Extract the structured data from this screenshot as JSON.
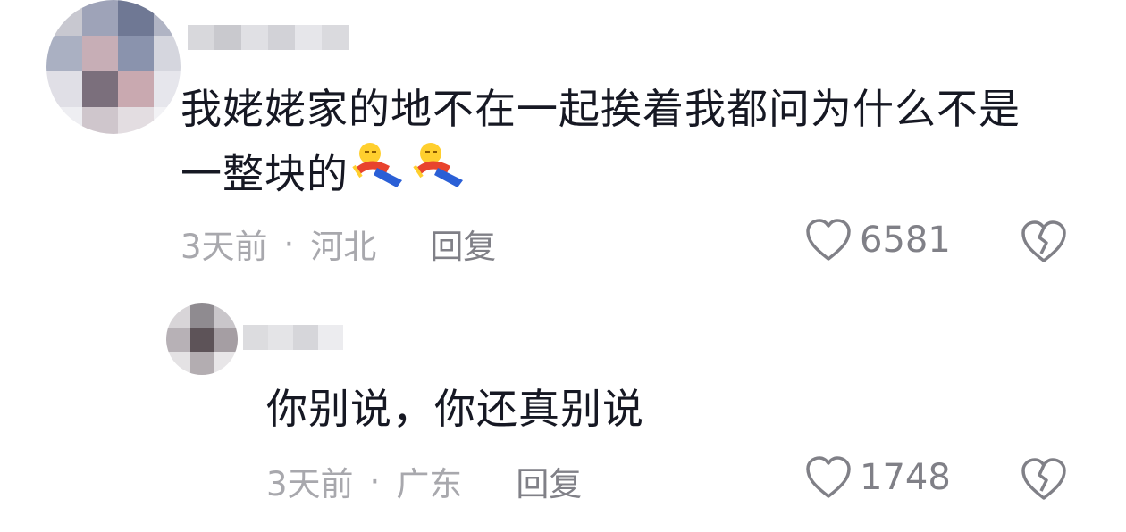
{
  "comments": [
    {
      "text_line1": "我姥姥家的地不在一起挨着我都问为什么不是",
      "text_line2": "一整块的",
      "emoji": "lying-flat-emoji",
      "time": "3天前",
      "separator": "·",
      "location": "河北",
      "reply_label": "回复",
      "like_count": "6581"
    },
    {
      "text": "你别说，你还真别说",
      "time": "3天前",
      "separator": "·",
      "location": "广东",
      "reply_label": "回复",
      "like_count": "1748"
    }
  ],
  "icons": {
    "like": "heart-outline-icon",
    "dislike": "broken-heart-icon"
  },
  "colors": {
    "text": "#161823",
    "meta": "#a8a8ad",
    "action": "#808087"
  }
}
